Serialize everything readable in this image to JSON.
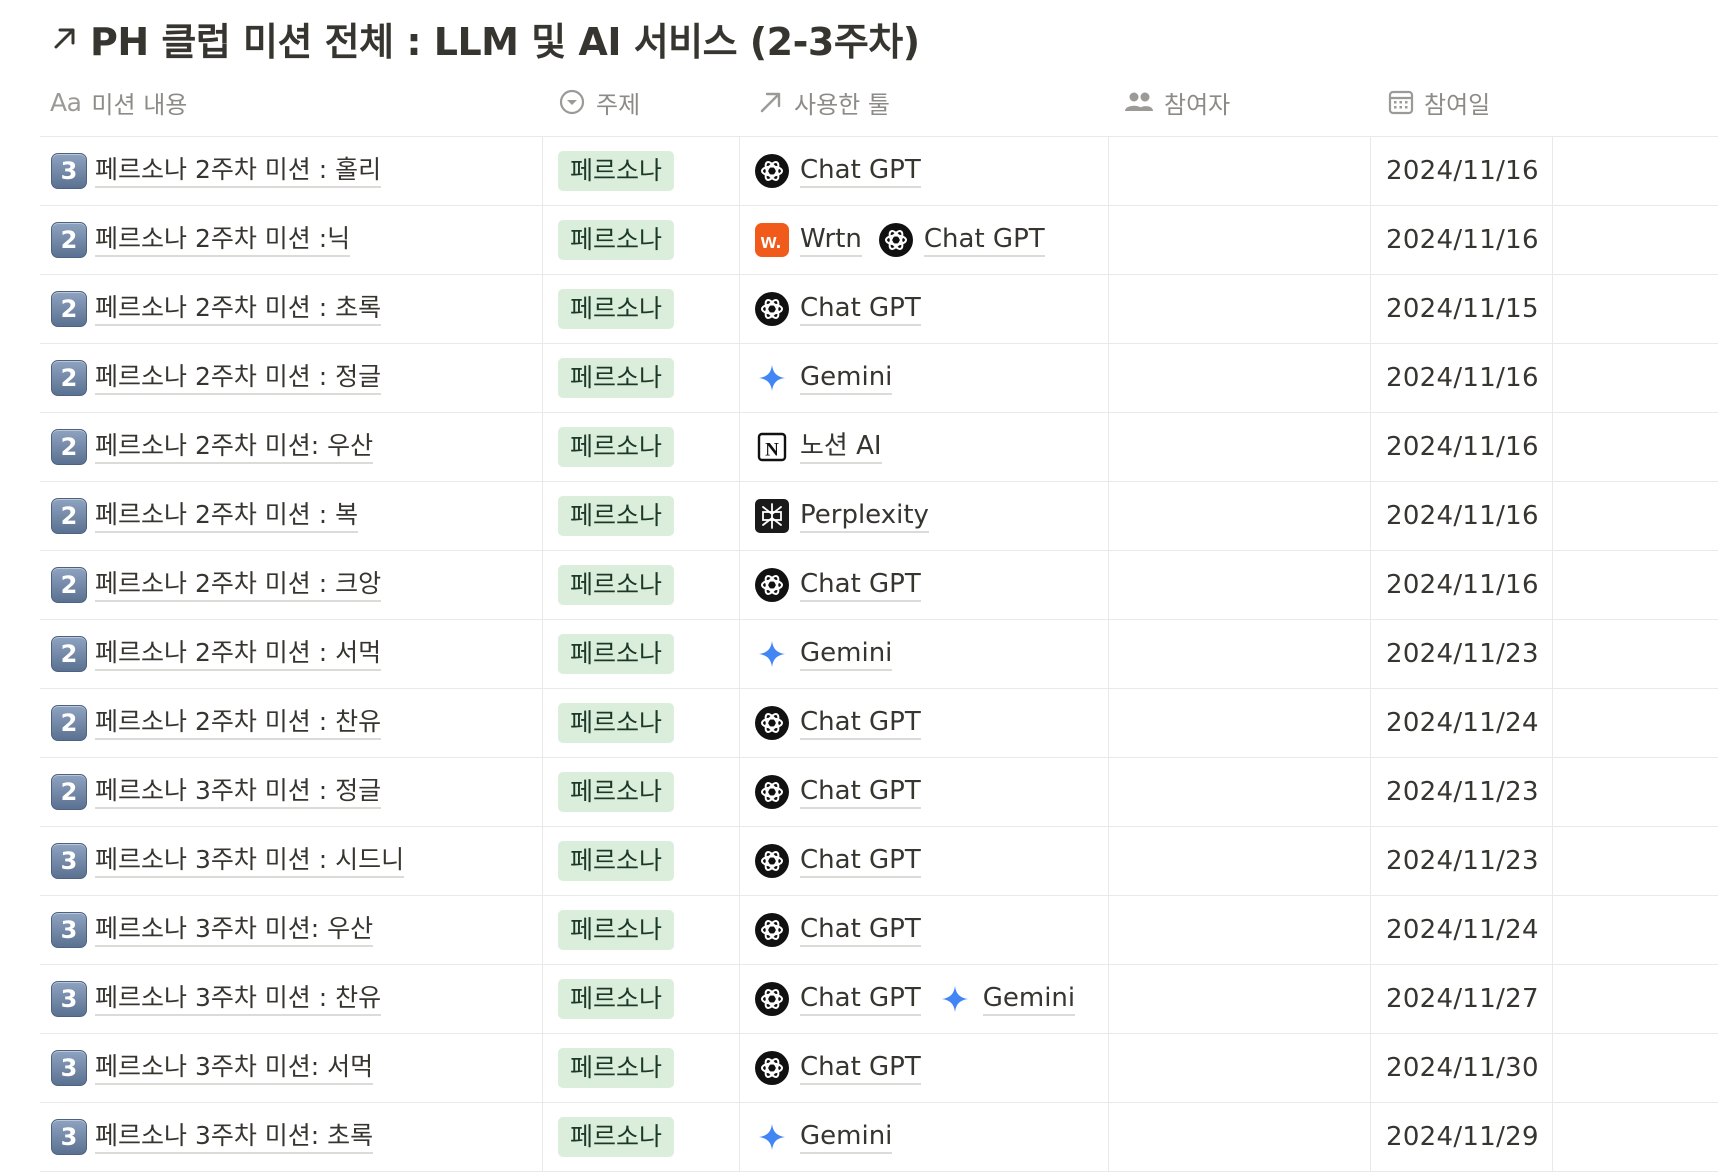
{
  "database": {
    "title": "PH 클럽 미션 전체 : LLM 및 AI 서비스 (2-3주차)"
  },
  "columns": {
    "title_prefix": "Aa",
    "title": "미션 내용",
    "topic": "주제",
    "tools": "사용한 툴",
    "participants": "참여자",
    "date": "참여일"
  },
  "colors": {
    "tag_bg": "#dbeddb",
    "tag_text": "#1c3829",
    "wrtn": "#f05a1a",
    "gemini": "#4285f4"
  },
  "rows": [
    {
      "num": "3",
      "title": "페르소나 2주차 미션 : 홀리",
      "topic": "페르소나",
      "tools": [
        {
          "name": "Chat GPT",
          "icon": "chatgpt-icon"
        }
      ],
      "date": "2024/11/16"
    },
    {
      "num": "2",
      "title": "페르소나 2주차 미션 :닉",
      "topic": "페르소나",
      "tools": [
        {
          "name": "Wrtn",
          "icon": "wrtn-icon"
        },
        {
          "name": "Chat GPT",
          "icon": "chatgpt-icon"
        }
      ],
      "date": "2024/11/16"
    },
    {
      "num": "2",
      "title": "페르소나 2주차 미션 : 초록",
      "topic": "페르소나",
      "tools": [
        {
          "name": "Chat GPT",
          "icon": "chatgpt-icon"
        }
      ],
      "date": "2024/11/15"
    },
    {
      "num": "2",
      "title": "페르소나 2주차 미션 : 정글",
      "topic": "페르소나",
      "tools": [
        {
          "name": "Gemini",
          "icon": "gemini-icon"
        }
      ],
      "date": "2024/11/16"
    },
    {
      "num": "2",
      "title": "페르소나 2주차 미션: 우산",
      "topic": "페르소나",
      "tools": [
        {
          "name": "노션 AI",
          "icon": "notion-icon"
        }
      ],
      "date": "2024/11/16"
    },
    {
      "num": "2",
      "title": "페르소나 2주차 미션 : 복",
      "topic": "페르소나",
      "tools": [
        {
          "name": "Perplexity",
          "icon": "perplexity-icon"
        }
      ],
      "date": "2024/11/16"
    },
    {
      "num": "2",
      "title": "페르소나 2주차 미션 : 크앙",
      "topic": "페르소나",
      "tools": [
        {
          "name": "Chat GPT",
          "icon": "chatgpt-icon"
        }
      ],
      "date": "2024/11/16"
    },
    {
      "num": "2",
      "title": "페르소나 2주차 미션 : 서먹",
      "topic": "페르소나",
      "tools": [
        {
          "name": "Gemini",
          "icon": "gemini-icon"
        }
      ],
      "date": "2024/11/23"
    },
    {
      "num": "2",
      "title": "페르소나 2주차 미션 : 찬유",
      "topic": "페르소나",
      "tools": [
        {
          "name": "Chat GPT",
          "icon": "chatgpt-icon"
        }
      ],
      "date": "2024/11/24"
    },
    {
      "num": "2",
      "title": "페르소나 3주차 미션 : 정글",
      "topic": "페르소나",
      "tools": [
        {
          "name": "Chat GPT",
          "icon": "chatgpt-icon"
        }
      ],
      "date": "2024/11/23"
    },
    {
      "num": "3",
      "title": "페르소나 3주차 미션 : 시드니",
      "topic": "페르소나",
      "tools": [
        {
          "name": "Chat GPT",
          "icon": "chatgpt-icon"
        }
      ],
      "date": "2024/11/23"
    },
    {
      "num": "3",
      "title": "페르소나 3주차 미션: 우산",
      "topic": "페르소나",
      "tools": [
        {
          "name": "Chat GPT",
          "icon": "chatgpt-icon"
        }
      ],
      "date": "2024/11/24"
    },
    {
      "num": "3",
      "title": "페르소나 3주차 미션 : 찬유",
      "topic": "페르소나",
      "tools": [
        {
          "name": "Chat GPT",
          "icon": "chatgpt-icon"
        },
        {
          "name": "Gemini",
          "icon": "gemini-icon"
        }
      ],
      "date": "2024/11/27"
    },
    {
      "num": "3",
      "title": "페르소나 3주차 미션: 서먹",
      "topic": "페르소나",
      "tools": [
        {
          "name": "Chat GPT",
          "icon": "chatgpt-icon"
        }
      ],
      "date": "2024/11/30"
    },
    {
      "num": "3",
      "title": "페르소나 3주차 미션: 초록",
      "topic": "페르소나",
      "tools": [
        {
          "name": "Gemini",
          "icon": "gemini-icon"
        }
      ],
      "date": "2024/11/29"
    }
  ]
}
